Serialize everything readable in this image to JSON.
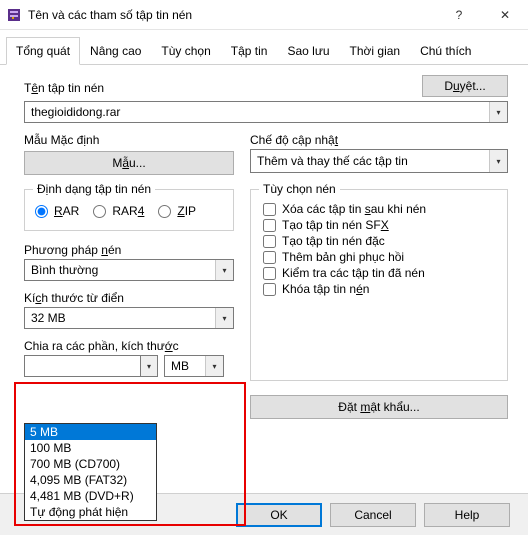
{
  "window": {
    "title": "Tên và các tham số tập tin nén"
  },
  "tabs": [
    "Tổng quát",
    "Nâng cao",
    "Tùy chọn",
    "Tập tin",
    "Sao lưu",
    "Thời gian",
    "Chú thích"
  ],
  "archive_name": {
    "label_pre": "T",
    "label_hot": "ê",
    "label_post": "n tập tin nén",
    "value": "thegioididong.rar"
  },
  "browse": {
    "pre": "D",
    "hot": "u",
    "post": "yệt..."
  },
  "profile": {
    "label": "Mẫu Mặc định",
    "button_pre": "M",
    "button_hot": "ẫ",
    "button_post": "u..."
  },
  "update_mode": {
    "label_pre": "Chế độ cập nhậ",
    "label_hot": "t",
    "value": "Thêm và thay thế các tập tin"
  },
  "format": {
    "legend": "Định dạng tập tin nén",
    "rar": "AR",
    "rar4": "RAR",
    "rar4_suf": "4",
    "zip": "IP"
  },
  "method": {
    "label_pre": "Phương pháp ",
    "label_hot": "n",
    "label_post": "én",
    "value": "Bình thường"
  },
  "dict": {
    "label_pre": "Kí",
    "label_hot": "c",
    "label_post": "h thước từ điển",
    "value": "32 MB"
  },
  "split": {
    "label_pre": "Chia ra các phần, kích thư",
    "label_hot": "ớ",
    "label_post": "c",
    "value": "",
    "unit": "MB",
    "options": [
      "5 MB",
      "100 MB",
      "700 MB  (CD700)",
      "4,095 MB  (FAT32)",
      "4,481 MB  (DVD+R)",
      "Tự động phát hiện"
    ]
  },
  "comp_opts": {
    "legend": "Tùy chọn nén",
    "o1_pre": "Xóa các tập tin ",
    "o1_hot": "s",
    "o1_post": "au khi nén",
    "o2_pre": "Tạo tập tin nén SF",
    "o2_hot": "X",
    "o3": "Tạo tập tin nén đặc",
    "o4": "Thêm bản ghi phục hồi",
    "o5": "Kiểm tra các tập tin đã nén",
    "o6_pre": "Khóa tập tin n",
    "o6_hot": "é",
    "o6_post": "n"
  },
  "password_btn_pre": "Đặt ",
  "password_btn_hot": "m",
  "password_btn_post": "ật khẩu...",
  "buttons": {
    "ok": "OK",
    "cancel": "Cancel",
    "help": "Help"
  },
  "icons": {
    "help": "?",
    "close": "✕",
    "caret": "▾"
  }
}
